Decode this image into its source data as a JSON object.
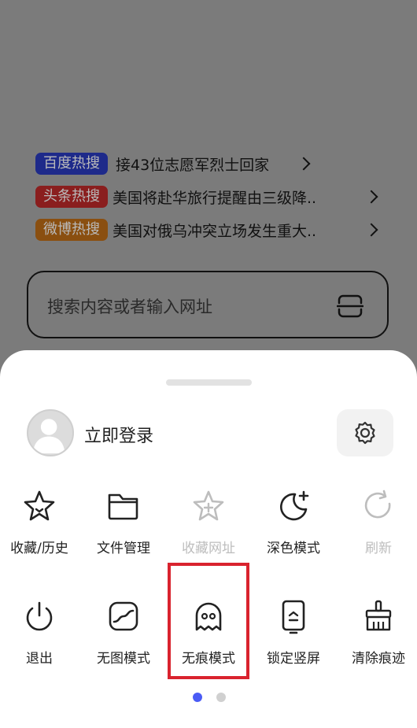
{
  "hot_searches": [
    {
      "badge": "百度热搜",
      "text": "接43位志愿军烈士回家",
      "badge_color": "#1e2a8a"
    },
    {
      "badge": "头条热搜",
      "text": "美国将赴华旅行提醒由三级降..",
      "badge_color": "#8a1e1e"
    },
    {
      "badge": "微博热搜",
      "text": "美国对俄乌冲突立场发生重大..",
      "badge_color": "#8a4f10"
    }
  ],
  "search": {
    "placeholder": "搜索内容或者输入网址",
    "scan_icon": "scan-icon"
  },
  "account": {
    "login_label": "立即登录",
    "avatar_icon": "user-avatar",
    "settings_icon": "gear-icon"
  },
  "menu_row1": [
    {
      "label": "收藏/历史",
      "icon": "star-icon",
      "enabled": true
    },
    {
      "label": "文件管理",
      "icon": "folder-icon",
      "enabled": true
    },
    {
      "label": "收藏网址",
      "icon": "star-plus-icon",
      "enabled": false
    },
    {
      "label": "深色模式",
      "icon": "moon-icon",
      "enabled": true
    },
    {
      "label": "刷新",
      "icon": "refresh-icon",
      "enabled": false
    }
  ],
  "menu_row2": [
    {
      "label": "退出",
      "icon": "power-icon",
      "enabled": true
    },
    {
      "label": "无图模式",
      "icon": "no-image-icon",
      "enabled": true
    },
    {
      "label": "无痕模式",
      "icon": "ghost-icon",
      "enabled": true
    },
    {
      "label": "锁定竖屏",
      "icon": "lock-portrait-icon",
      "enabled": true
    },
    {
      "label": "清除痕迹",
      "icon": "broom-icon",
      "enabled": true
    }
  ],
  "pagination": {
    "pages": 2,
    "current": 1,
    "active_color": "#4a5bf5",
    "inactive_color": "#d0d0d0"
  },
  "highlight_color": "#d9232e"
}
